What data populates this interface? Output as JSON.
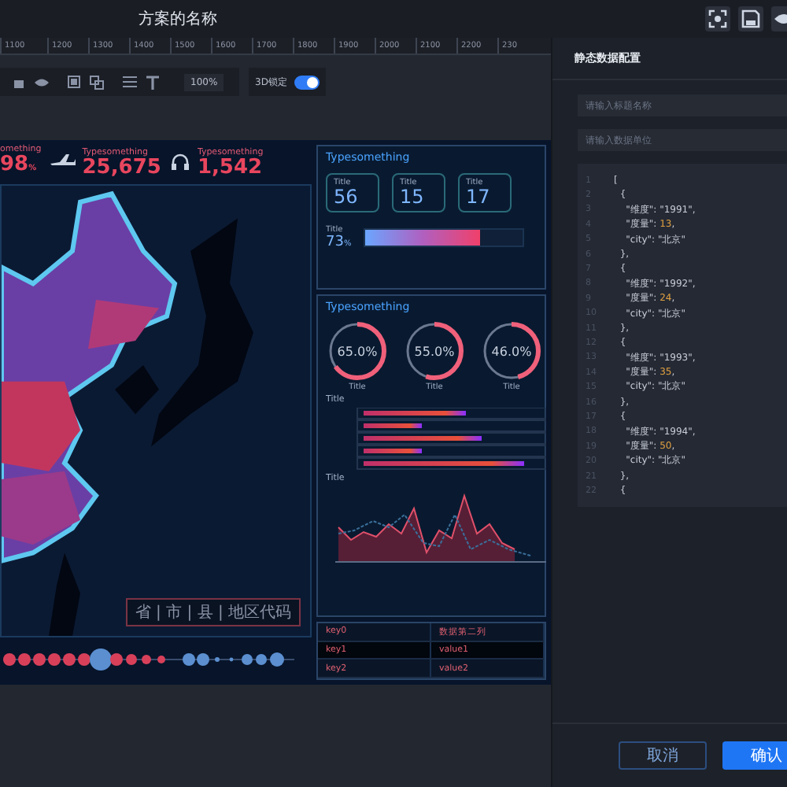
{
  "window": {
    "title": "方案的名称"
  },
  "ruler": [
    "1100",
    "1200",
    "1300",
    "1400",
    "1500",
    "1600",
    "1700",
    "1800",
    "1900",
    "2000",
    "2100",
    "2200",
    "230"
  ],
  "toolbar": {
    "zoom": "100%",
    "lock_label": "3D锁定",
    "lock_on": true
  },
  "stats": [
    {
      "label": "omething",
      "value": "98",
      "unit": "%",
      "kind": "plain"
    },
    {
      "label": "Typesomething",
      "value": "25,675",
      "kind": "plane"
    },
    {
      "label": "Typesomething",
      "value": "1,542",
      "kind": "headset"
    }
  ],
  "map": {
    "search_placeholder": "省 | 市 | 县 | 地区代码"
  },
  "panel_1": {
    "title": "Typesomething",
    "cards": [
      {
        "label": "Title",
        "value": "56"
      },
      {
        "label": "Title",
        "value": "15"
      },
      {
        "label": "Title",
        "value": "17"
      }
    ],
    "progress": {
      "label": "Title",
      "value": "73",
      "unit": "%",
      "level": 0.73
    }
  },
  "panel_2": {
    "title": "Typesomething",
    "donuts": [
      {
        "value": "65.0%",
        "label": "Title",
        "level": 0.65
      },
      {
        "value": "55.0%",
        "label": "Title",
        "level": 0.55
      },
      {
        "value": "46.0%",
        "label": "Title",
        "level": 0.46
      }
    ],
    "bar_title": "Title",
    "line_title": "Title"
  },
  "table": [
    [
      "key0",
      "数据第二列"
    ],
    [
      "key1",
      "value1"
    ],
    [
      "key2",
      "value2"
    ]
  ],
  "config": {
    "title": "静态数据配置",
    "title_placeholder": "请输入标题名称",
    "unit_placeholder": "请输入数据单位",
    "code": [
      {
        "n": "1",
        "text": "["
      },
      {
        "n": "2",
        "text": "  {"
      },
      {
        "n": "3",
        "text": "    \"维度\": \"1991\","
      },
      {
        "n": "4",
        "text": "    \"度量\": ",
        "num": "13",
        "tail": ","
      },
      {
        "n": "5",
        "text": "    \"city\": \"北京\""
      },
      {
        "n": "6",
        "text": "  },"
      },
      {
        "n": "7",
        "text": "  {"
      },
      {
        "n": "8",
        "text": "    \"维度\": \"1992\","
      },
      {
        "n": "9",
        "text": "    \"度量\": ",
        "num": "24",
        "tail": ","
      },
      {
        "n": "10",
        "text": "    \"city\": \"北京\""
      },
      {
        "n": "11",
        "text": "  },"
      },
      {
        "n": "12",
        "text": "  {"
      },
      {
        "n": "13",
        "text": "    \"维度\": \"1993\","
      },
      {
        "n": "14",
        "text": "    \"度量\": ",
        "num": "35",
        "tail": ","
      },
      {
        "n": "15",
        "text": "    \"city\": \"北京\""
      },
      {
        "n": "16",
        "text": "  },"
      },
      {
        "n": "17",
        "text": "  {"
      },
      {
        "n": "18",
        "text": "    \"维度\": \"1994\","
      },
      {
        "n": "19",
        "text": "    \"度量\": ",
        "num": "50",
        "tail": ","
      },
      {
        "n": "20",
        "text": "    \"city\": \"北京\""
      },
      {
        "n": "21",
        "text": "  },"
      },
      {
        "n": "22",
        "text": "  {"
      }
    ],
    "buttons": [
      {
        "label": "取消",
        "kind": "secondary"
      },
      {
        "label": "确认",
        "kind": "primary"
      }
    ]
  }
}
